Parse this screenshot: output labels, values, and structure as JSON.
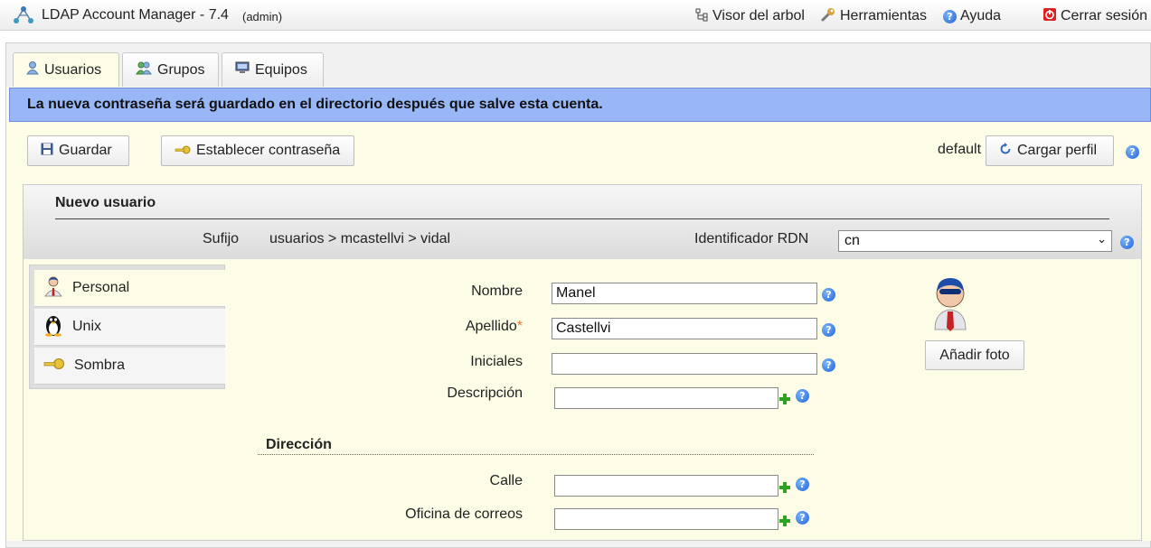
{
  "app": {
    "title": "LDAP Account Manager - 7.4",
    "user": "(admin)"
  },
  "topnav": {
    "tree_view": "Visor del arbol",
    "tools": "Herramientas",
    "help": "Ayuda",
    "logout": "Cerrar sesión"
  },
  "tabs": [
    {
      "label": "Usuarios",
      "icon": "user-icon"
    },
    {
      "label": "Grupos",
      "icon": "group-icon"
    },
    {
      "label": "Equipos",
      "icon": "computer-icon"
    }
  ],
  "notice": "La nueva contraseña será guardado en el directorio después que salve esta cuenta.",
  "toolbar": {
    "save": "Guardar",
    "set_password": "Establecer contraseña",
    "profile_name": "default",
    "load_profile": "Cargar perfil"
  },
  "account": {
    "heading": "Nuevo usuario",
    "suffix_label": "Sufijo",
    "suffix_value": "usuarios > mcastellvi > vidal",
    "rdn_label": "Identificador RDN",
    "rdn_value": "cn"
  },
  "side_menu": [
    {
      "label": "Personal",
      "icon": "person-icon"
    },
    {
      "label": "Unix",
      "icon": "tux-icon"
    },
    {
      "label": "Sombra",
      "icon": "key-icon"
    }
  ],
  "form": {
    "first_name_label": "Nombre",
    "first_name_value": "Manel",
    "last_name_label": "Apellido",
    "last_name_required": "*",
    "last_name_value": "Castellvi",
    "initials_label": "Iniciales",
    "initials_value": "",
    "description_label": "Descripción",
    "description_value": "",
    "address_heading": "Dirección",
    "street_label": "Calle",
    "street_value": "",
    "po_box_label": "Oficina de correos",
    "po_box_value": ""
  },
  "photo": {
    "add_photo": "Añadir foto"
  },
  "colors": {
    "notice_bg": "#99b7f7",
    "content_bg": "#fdfce7",
    "help_icon": "#1f62d6",
    "add_icon": "#2ea31f",
    "required_mark": "#e8742a"
  }
}
